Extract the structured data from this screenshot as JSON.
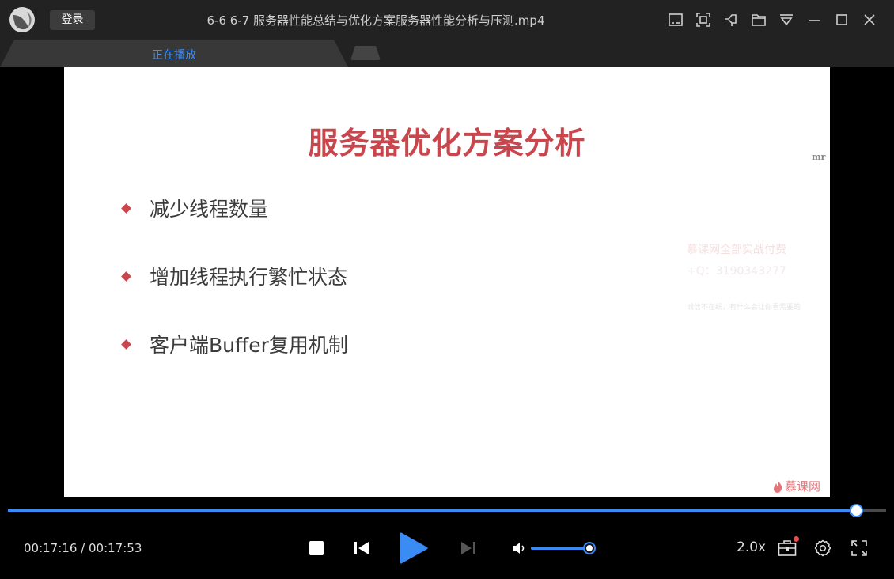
{
  "app": {
    "login_label": "登录",
    "file_title": "6-6 6-7 服务器性能总结与优化方案服务器性能分析与压测.mp4"
  },
  "tabs": {
    "active_label": "正在播放"
  },
  "window_icons": [
    "mini-mode-icon",
    "screenshot-icon",
    "pin-icon",
    "folder-icon",
    "menu-icon",
    "minimize-icon",
    "maximize-icon",
    "close-icon"
  ],
  "slide": {
    "title": "服务器优化方案分析",
    "corner_tag": "mr",
    "bullets": [
      "减少线程数量",
      "增加线程执行繁忙状态",
      "客户端Buffer复用机制"
    ],
    "watermark_line1": "慕课网全部实战付费",
    "watermark_line2": "+Q：3190343277",
    "watermark_line3": "诚信不在线，有什么会让你看需要的",
    "brand": "慕课网"
  },
  "player": {
    "current_time": "00:17:16",
    "separator": "/",
    "total_time": "00:17:53",
    "progress": 0.966,
    "volume": 1.0,
    "speed": "2.0x"
  },
  "colors": {
    "accent": "#3a8bf3",
    "title_red": "#c8464c",
    "bg": "#000000",
    "bar": "#222222"
  }
}
